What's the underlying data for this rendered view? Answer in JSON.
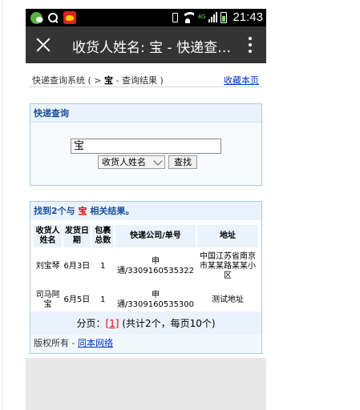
{
  "status_bar": {
    "time": "21:43",
    "network": "4G",
    "icons": [
      "wechat-icon",
      "search-icon",
      "app-icon",
      "vibrate-icon",
      "wifi-icon",
      "signal-icon",
      "battery-icon"
    ]
  },
  "app_bar": {
    "title": "收货人姓名: 宝 - 快递查询结果",
    "close_icon": "close-icon",
    "more_icon": "more-vert-icon"
  },
  "breadcrumb": {
    "prefix": "快递查询系统 ( > ",
    "bold": "宝",
    "suffix": " - 查询结果 )",
    "favorite_link": "收藏本页"
  },
  "search": {
    "heading": "快递查询",
    "input_value": "宝",
    "select_value": "收货人姓名",
    "button_label": "查找"
  },
  "results": {
    "heading_prefix": "找到2个与 ",
    "keyword": "宝",
    "heading_suffix": " 相关结果。",
    "columns": [
      "收货人姓名",
      "发货日期",
      "包裹总数",
      "快递公司/单号",
      "地址"
    ],
    "rows": [
      {
        "name": "刘宝琴",
        "date": "6月3日",
        "count": "1",
        "courier": "申通/3309160535322",
        "address": "中国江苏省南京市某某路某某小区"
      },
      {
        "name": "司马阿宝",
        "date": "6月5日",
        "count": "1",
        "courier": "申通/3309160535300",
        "address": "测试地址"
      }
    ],
    "pager_label": "分页：",
    "pager_current": "[1]",
    "pager_summary": " (共计2个，每页10个)"
  },
  "footer": {
    "copyright": "版权所有 - ",
    "link": "同本网络"
  },
  "colors": {
    "status_bar": "#000000",
    "app_bar": "#343434",
    "heading_blue": "#1a4f9c",
    "keyword_red": "#e60000",
    "panel_border": "#a9c9e6"
  }
}
